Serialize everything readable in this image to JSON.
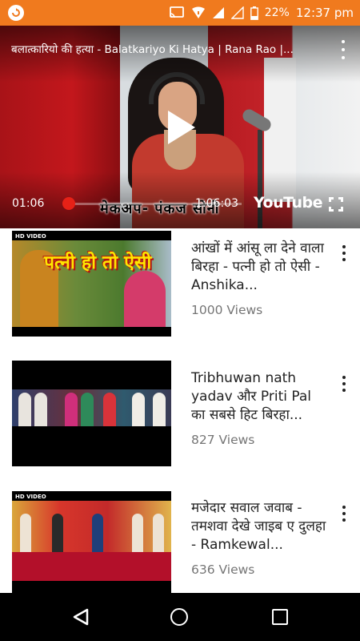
{
  "status_bar": {
    "battery_percent": "22%",
    "time": "12:37 pm",
    "background_color": "#f07a1e",
    "icons": [
      "app-icon",
      "cast-icon",
      "wifi-icon",
      "signal-icon",
      "battery-icon"
    ]
  },
  "player": {
    "title": "बलात्कारियो की हत्या - Balatkariyo Ki Hatya | Rana Rao |...",
    "elapsed": "01:06",
    "duration": "1:06:03",
    "progress_fraction": 0.017,
    "logo_text": "YouTube",
    "overlay_caption": "मेकअप- पंकज सोनी",
    "accent_color": "#e62117"
  },
  "videos": [
    {
      "title": "आंखों में आंसू ला देने वाला बिरहा - पत्नी हो तो ऐसी - Anshika...",
      "views": "1000 Views",
      "thumb_badge": "HD VIDEO",
      "thumb_headline": "पत्नी हो तो ऐसी"
    },
    {
      "title": "Tribhuwan nath yadav और Priti Pal का सबसे हिट बिरहा...",
      "views": "827 Views"
    },
    {
      "title": "मजेदार सवाल जवाब - तमशवा देखे जाइब ए दुलहा - Ramkewal...",
      "views": "636 Views",
      "thumb_badge": "HD VIDEO"
    }
  ]
}
